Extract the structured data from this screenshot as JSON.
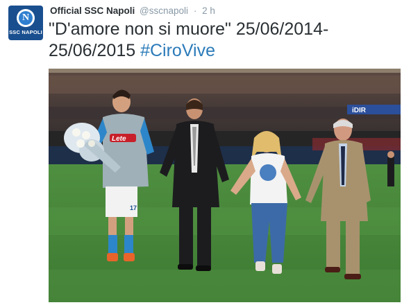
{
  "tweet": {
    "account_name": "Official SSC Napoli",
    "handle": "@sscnapoli",
    "separator": "·",
    "time": "2 h",
    "text_quote": "\"D'amore non si muore\" 25/06/2014-25/06/2015 ",
    "hashtag": "#CiroVive"
  },
  "avatar": {
    "initial": "N",
    "label": "SSC NAPOLI"
  },
  "photo": {
    "shirt_sponsor": "Lete",
    "shirt_number": "17",
    "board_text": "iDIR"
  },
  "colors": {
    "brand_blue": "#1a4f8f",
    "hashtag_blue": "#2b7bb9",
    "pitch_green": "#4b8b3f",
    "napoli_shirt": "#9fb0b8"
  }
}
